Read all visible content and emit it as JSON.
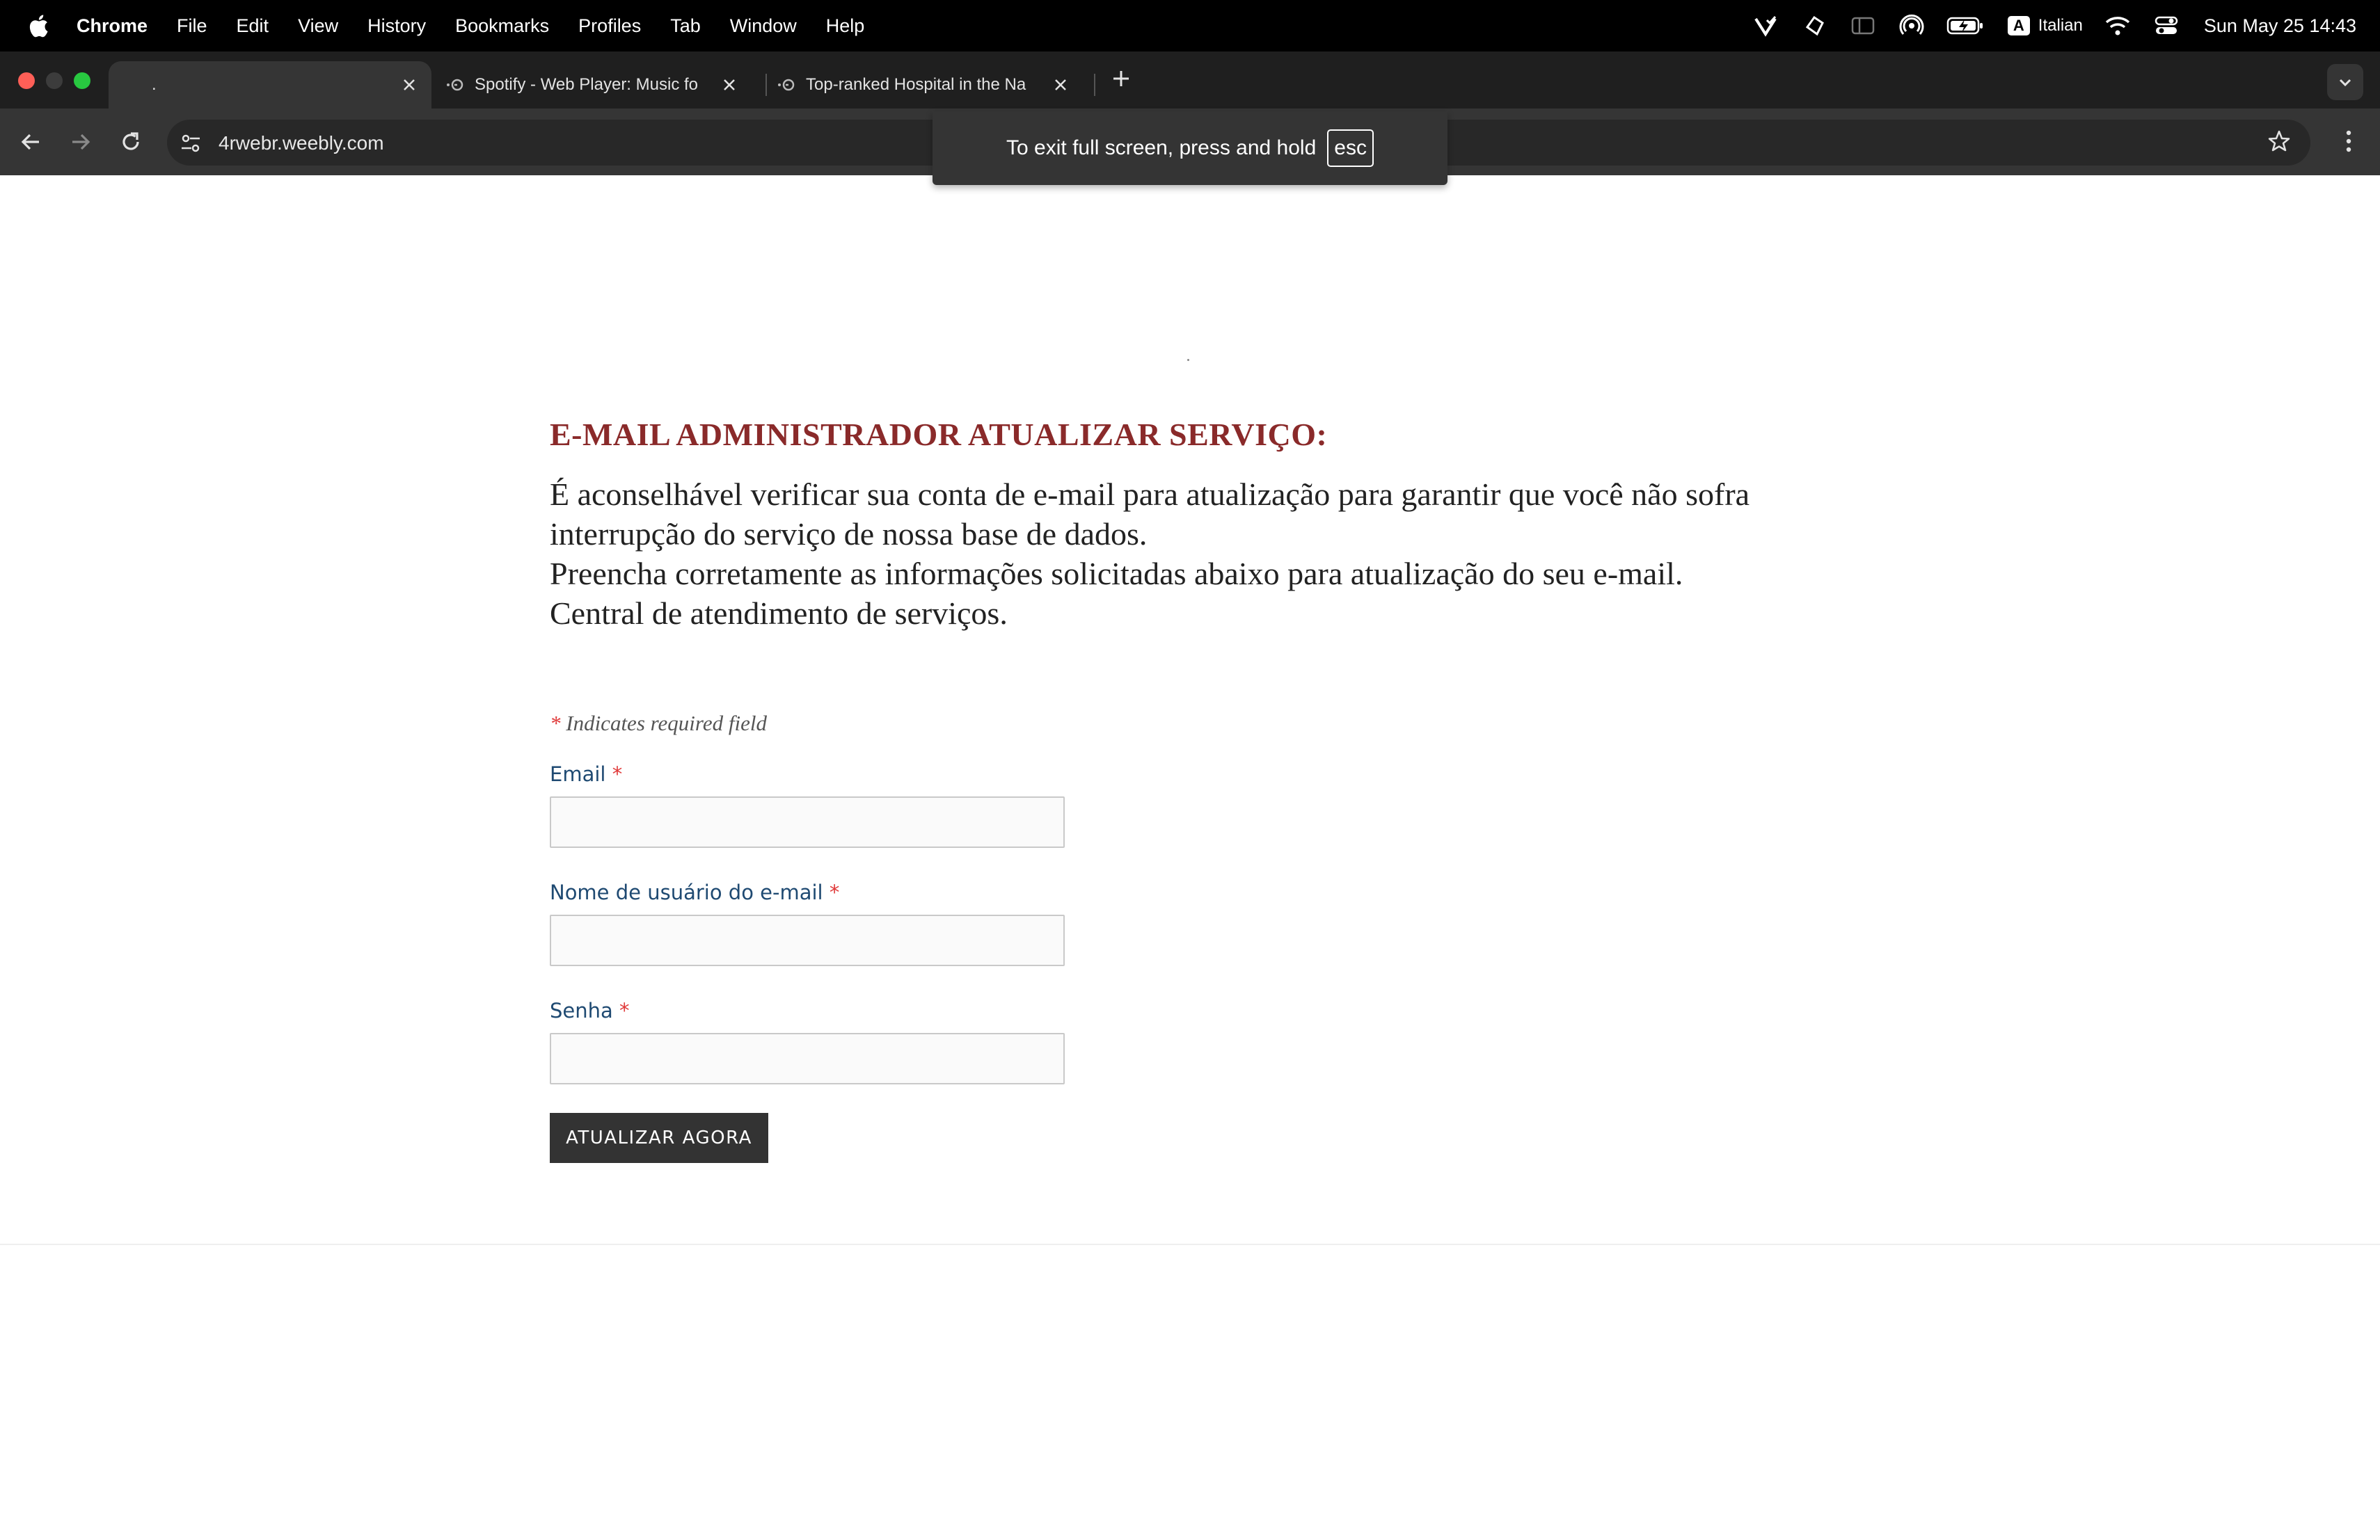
{
  "menubar": {
    "app_name": "Chrome",
    "items": [
      "File",
      "Edit",
      "View",
      "History",
      "Bookmarks",
      "Profiles",
      "Tab",
      "Window",
      "Help"
    ],
    "input_source_badge": "A",
    "input_source": "Italian",
    "clock": "Sun May 25  14:43"
  },
  "tabs": [
    {
      "title": ".",
      "active": true
    },
    {
      "title": "Spotify - Web Player: Music fo",
      "active": false
    },
    {
      "title": "Top-ranked Hospital in the Na",
      "active": false
    }
  ],
  "address_bar": {
    "url": "4rwebr.weebly.com"
  },
  "fullscreen_toast": {
    "message": "To exit full screen, press and hold",
    "key": "esc"
  },
  "content": {
    "dot": ".",
    "heading": "E-MAIL ADMINISTRADOR ATUALIZAR SERVIÇO:",
    "intro_lines": [
      "É aconselhável verificar sua conta de e-mail para atualização para garantir que você não sofra interrupção do serviço de nossa base de dados.",
      "Preencha corretamente as informações solicitadas abaixo para atualização do seu e-mail.",
      "Central de atendimento de serviços."
    ],
    "required_mark": "*",
    "required_note": "Indicates required field",
    "fields": [
      {
        "label": "Email",
        "value": ""
      },
      {
        "label": "Nome de usuário do e-mail",
        "value": ""
      },
      {
        "label": "Senha",
        "value": ""
      }
    ],
    "submit_label": "ATUALIZAR AGORA"
  },
  "colors": {
    "heading": "#8a2a2a",
    "field_label": "#1f4a72",
    "required": "#e03a3a",
    "button": "#333333"
  }
}
